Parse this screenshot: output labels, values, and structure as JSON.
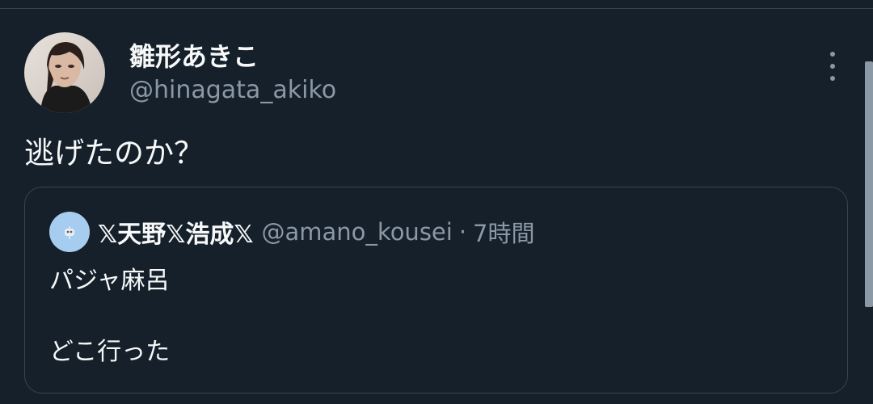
{
  "tweet": {
    "display_name": "雛形あきこ",
    "handle": "@hinagata_akiko",
    "text": "逃げたのか？"
  },
  "quote": {
    "display_name": "𝕏天野𝕏浩成𝕏",
    "handle": "@amano_kousei",
    "separator": "·",
    "time": "7時間",
    "lines": [
      "パジャ麻呂",
      "どこ行った"
    ]
  },
  "icons": {
    "more": "more-vertical-icon"
  },
  "colors": {
    "background": "#15202b",
    "text_primary": "#f7f9f9",
    "text_secondary": "#8b98a5",
    "border": "#38444d"
  }
}
